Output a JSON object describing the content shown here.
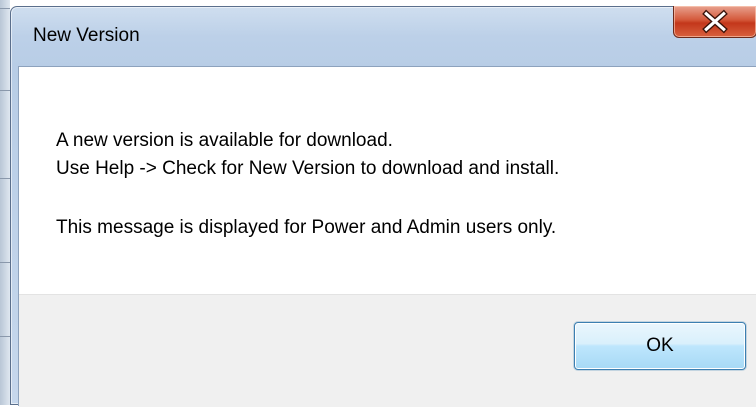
{
  "dialog": {
    "title": "New Version",
    "close_icon": "close-icon",
    "message_lines": [
      "A new version is available for download.",
      "Use Help -> Check for New Version to download and install.",
      "This message is displayed for Power and Admin users only."
    ],
    "ok_label": "OK"
  },
  "colors": {
    "title_bar": "#bcd0e8",
    "close_button": "#c3371b",
    "footer": "#f0f0f0",
    "ok_button_border": "#3c7fb1"
  }
}
